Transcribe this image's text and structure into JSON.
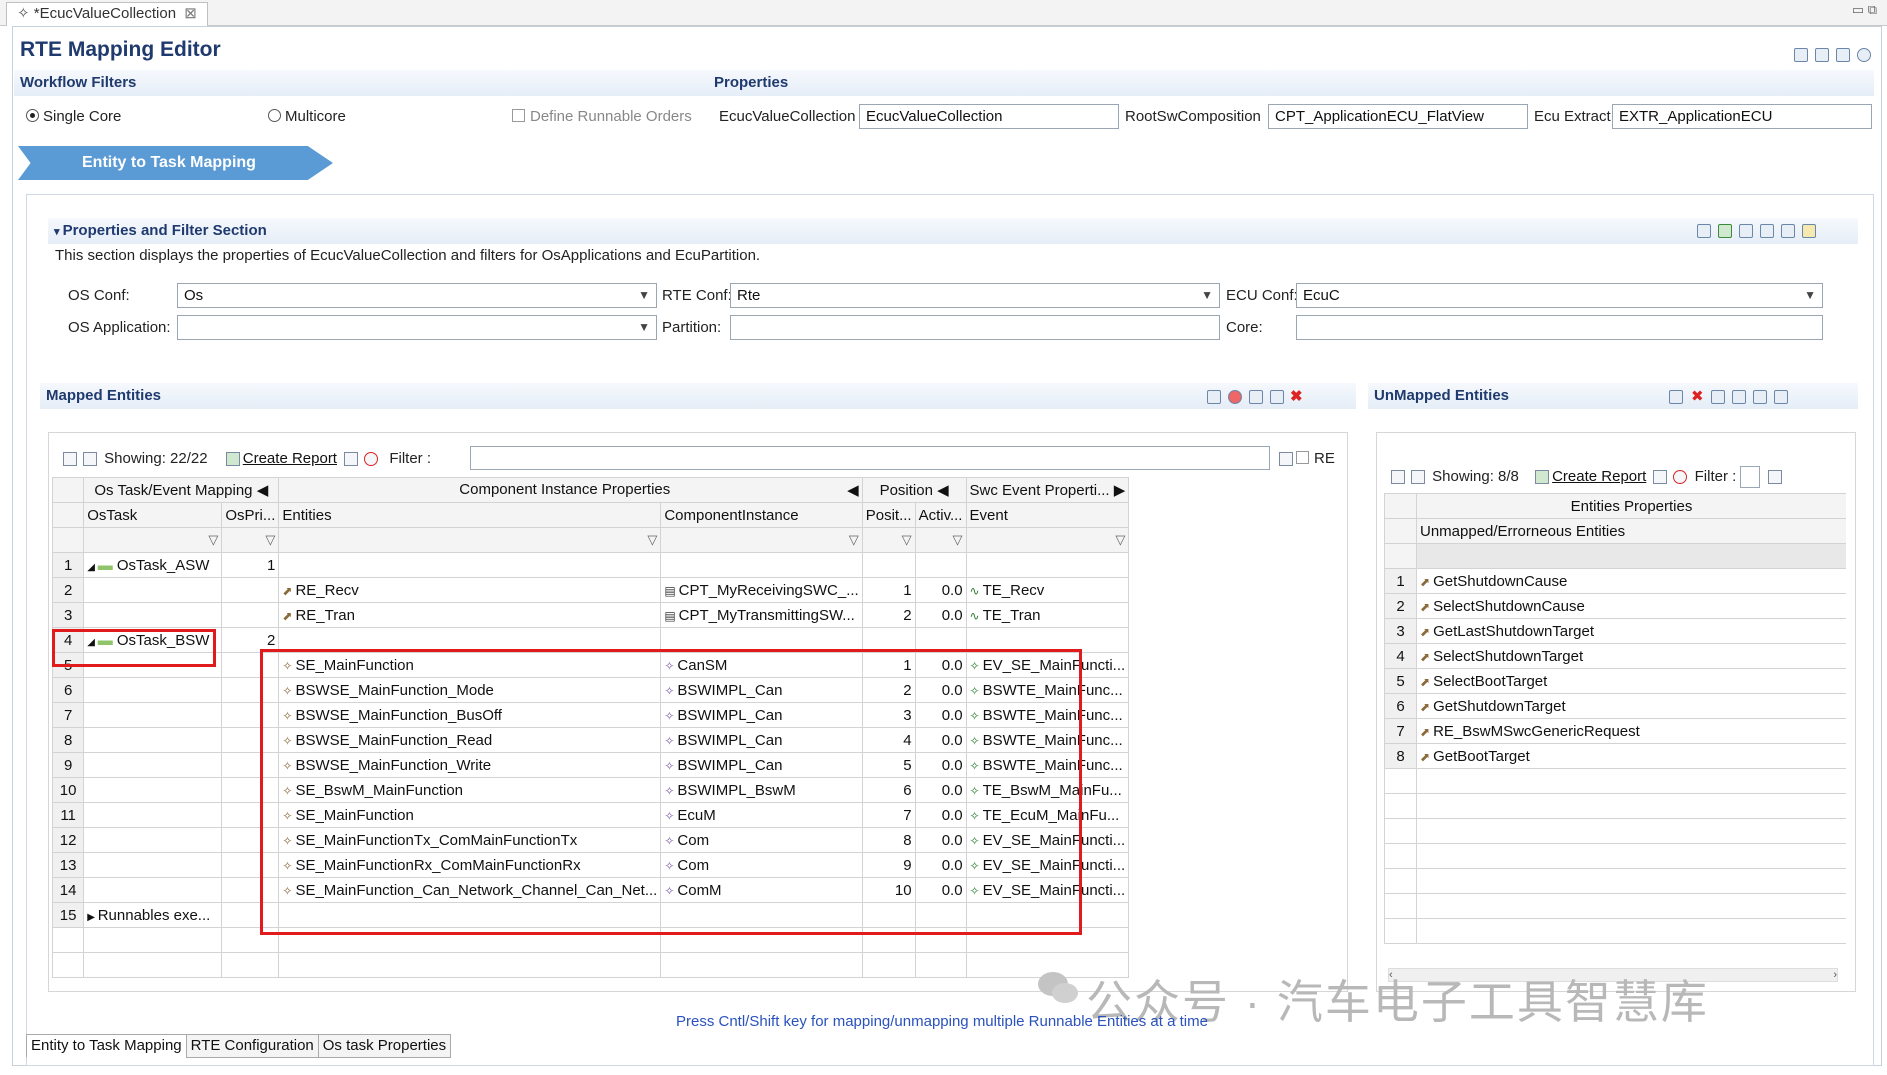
{
  "editor_tab": {
    "label": "*EcucValueCollection",
    "close": "⊠"
  },
  "window_controls": "▭ ⧉",
  "title": "RTE Mapping Editor",
  "workflow": {
    "heading": "Workflow Filters",
    "single_core": "Single Core",
    "multicore": "Multicore",
    "define_runnable_orders": "Define Runnable Orders",
    "step_label": "Entity to Task Mapping"
  },
  "properties": {
    "heading": "Properties",
    "ecuc_label": "EcucValueCollection",
    "ecuc_value": "EcucValueCollection",
    "root_label": "RootSwComposition",
    "root_value": "CPT_ApplicationECU_FlatView",
    "extract_label": "Ecu Extract",
    "extract_value": "EXTR_ApplicationECU"
  },
  "filter_section": {
    "heading": "Properties and Filter Section",
    "description": "This section displays the properties of EcucValueCollection and filters for OsApplications and EcuPartition.",
    "os_conf_label": "OS Conf:",
    "os_conf_value": "Os",
    "rte_conf_label": "RTE Conf:",
    "rte_conf_value": "Rte",
    "ecu_conf_label": "ECU Conf:",
    "ecu_conf_value": "EcuC",
    "os_app_label": "OS Application:",
    "os_app_value": "",
    "partition_label": "Partition:",
    "partition_value": "",
    "core_label": "Core:",
    "core_value": ""
  },
  "mapped": {
    "heading": "Mapped Entities",
    "showing": "Showing: 22/22",
    "create_report": "Create Report",
    "filter_label": "Filter :",
    "filter_value": "",
    "re_label": "RE",
    "group_headers": [
      "Os Task/Event Mapping",
      "Component Instance Properties",
      "Position",
      "Swc Event Properti..."
    ],
    "columns": [
      "OsTask",
      "OsPri...",
      "Entities",
      "ComponentInstance",
      "Posit...",
      "Activ...",
      "Event"
    ],
    "rows": [
      {
        "n": "1",
        "task": "OsTask_ASW",
        "pri": "1",
        "entity": "",
        "comp": "",
        "pos": "",
        "act": "",
        "event": ""
      },
      {
        "n": "2",
        "task": "",
        "pri": "",
        "entity": "RE_Recv",
        "comp": "CPT_MyReceivingSWC_...",
        "pos": "1",
        "act": "0.0",
        "event": "TE_Recv"
      },
      {
        "n": "3",
        "task": "",
        "pri": "",
        "entity": "RE_Tran",
        "comp": "CPT_MyTransmittingSW...",
        "pos": "2",
        "act": "0.0",
        "event": "TE_Tran"
      },
      {
        "n": "4",
        "task": "OsTask_BSW",
        "pri": "2",
        "entity": "",
        "comp": "",
        "pos": "",
        "act": "",
        "event": ""
      },
      {
        "n": "5",
        "task": "",
        "pri": "",
        "entity": "SE_MainFunction",
        "comp": "CanSM",
        "pos": "1",
        "act": "0.0",
        "event": "EV_SE_MainFuncti..."
      },
      {
        "n": "6",
        "task": "",
        "pri": "",
        "entity": "BSWSE_MainFunction_Mode",
        "comp": "BSWIMPL_Can",
        "pos": "2",
        "act": "0.0",
        "event": "BSWTE_MainFunc..."
      },
      {
        "n": "7",
        "task": "",
        "pri": "",
        "entity": "BSWSE_MainFunction_BusOff",
        "comp": "BSWIMPL_Can",
        "pos": "3",
        "act": "0.0",
        "event": "BSWTE_MainFunc..."
      },
      {
        "n": "8",
        "task": "",
        "pri": "",
        "entity": "BSWSE_MainFunction_Read",
        "comp": "BSWIMPL_Can",
        "pos": "4",
        "act": "0.0",
        "event": "BSWTE_MainFunc..."
      },
      {
        "n": "9",
        "task": "",
        "pri": "",
        "entity": "BSWSE_MainFunction_Write",
        "comp": "BSWIMPL_Can",
        "pos": "5",
        "act": "0.0",
        "event": "BSWTE_MainFunc..."
      },
      {
        "n": "10",
        "task": "",
        "pri": "",
        "entity": "SE_BswM_MainFunction",
        "comp": "BSWIMPL_BswM",
        "pos": "6",
        "act": "0.0",
        "event": "TE_BswM_MainFu..."
      },
      {
        "n": "11",
        "task": "",
        "pri": "",
        "entity": "SE_MainFunction",
        "comp": "EcuM",
        "pos": "7",
        "act": "0.0",
        "event": "TE_EcuM_MainFu..."
      },
      {
        "n": "12",
        "task": "",
        "pri": "",
        "entity": "SE_MainFunctionTx_ComMainFunctionTx",
        "comp": "Com",
        "pos": "8",
        "act": "0.0",
        "event": "EV_SE_MainFuncti..."
      },
      {
        "n": "13",
        "task": "",
        "pri": "",
        "entity": "SE_MainFunctionRx_ComMainFunctionRx",
        "comp": "Com",
        "pos": "9",
        "act": "0.0",
        "event": "EV_SE_MainFuncti..."
      },
      {
        "n": "14",
        "task": "",
        "pri": "",
        "entity": "SE_MainFunction_Can_Network_Channel_Can_Net...",
        "comp": "ComM",
        "pos": "10",
        "act": "0.0",
        "event": "EV_SE_MainFuncti..."
      },
      {
        "n": "15",
        "task": "Runnables exe...",
        "pri": "",
        "entity": "",
        "comp": "",
        "pos": "",
        "act": "",
        "event": ""
      }
    ]
  },
  "unmapped": {
    "heading": "UnMapped Entities",
    "showing": "Showing: 8/8",
    "create_report": "Create Report",
    "filter_label": "Filter :",
    "group_header": "Entities Properties",
    "column": "Unmapped/Errorneous Entities",
    "rows": [
      {
        "n": "1",
        "name": "GetShutdownCause"
      },
      {
        "n": "2",
        "name": "SelectShutdownCause"
      },
      {
        "n": "3",
        "name": "GetLastShutdownTarget"
      },
      {
        "n": "4",
        "name": "SelectShutdownTarget"
      },
      {
        "n": "5",
        "name": "SelectBootTarget"
      },
      {
        "n": "6",
        "name": "GetShutdownTarget"
      },
      {
        "n": "7",
        "name": "RE_BswMSwcGenericRequest"
      },
      {
        "n": "8",
        "name": "GetBootTarget"
      }
    ]
  },
  "status_hint": "Press Cntl/Shift key for mapping/unmapping multiple Runnable Entities at a time",
  "watermark": "公众号 · 汽车电子工具智慧库",
  "bottom_tabs": [
    "Entity to Task Mapping",
    "RTE Configuration",
    "Os task Properties"
  ],
  "colors": {
    "accent": "#5b9bd5",
    "highlight": "#e11b1b",
    "heading": "#1f3a6e"
  }
}
